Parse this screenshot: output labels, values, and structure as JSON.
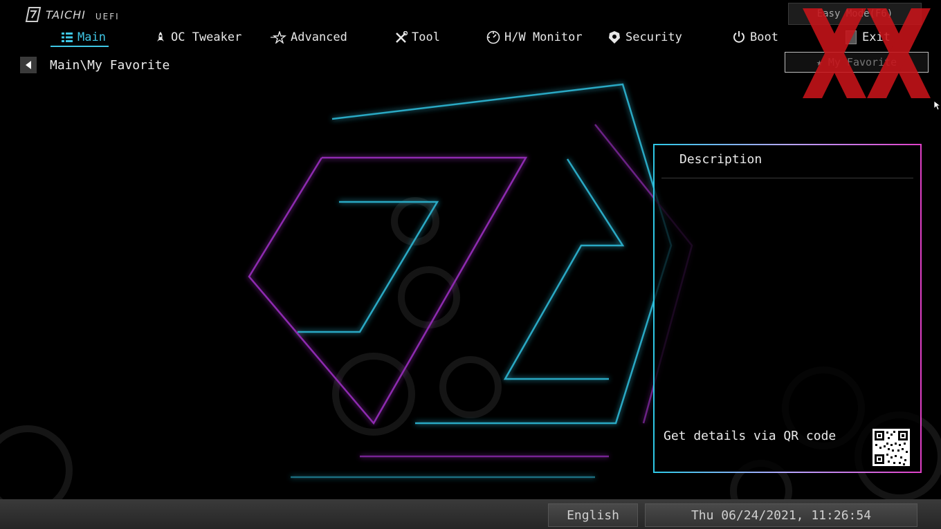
{
  "brand": {
    "name": "TAICHI",
    "suffix": "UEFI",
    "logo_icon": "taichi-logo-icon"
  },
  "nav": {
    "active": "main",
    "items": [
      {
        "id": "main",
        "label": "Main",
        "icon": "list-icon"
      },
      {
        "id": "oc",
        "label": "OC Tweaker",
        "icon": "rocket-icon"
      },
      {
        "id": "advanced",
        "label": "Advanced",
        "icon": "star-icon"
      },
      {
        "id": "tool",
        "label": "Tool",
        "icon": "tools-icon"
      },
      {
        "id": "hwmon",
        "label": "H/W Monitor",
        "icon": "monitor-icon"
      },
      {
        "id": "security",
        "label": "Security",
        "icon": "shield-icon"
      },
      {
        "id": "boot",
        "label": "Boot",
        "icon": "power-icon"
      },
      {
        "id": "exit",
        "label": "Exit",
        "icon": "exit-icon"
      }
    ]
  },
  "header": {
    "easy_mode_label": "Easy Mode(F6)",
    "favorite_label": "My Favorite"
  },
  "breadcrumb": {
    "path": "Main\\My Favorite"
  },
  "description": {
    "title": "Description",
    "qr_label": "Get details via QR code"
  },
  "status_bar": {
    "language": "English",
    "datetime": "Thu 06/24/2021, 11:26:54"
  },
  "colors": {
    "accent": "#3fc7e6",
    "magenta": "#e040c8",
    "watermark": "#d22"
  }
}
